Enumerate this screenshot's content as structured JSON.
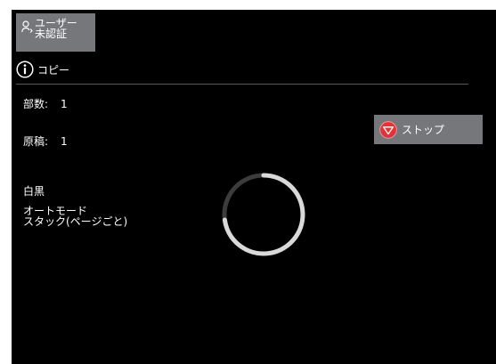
{
  "user": {
    "line1": "ユーザー",
    "line2": "未認証",
    "icon": "user-icon"
  },
  "header": {
    "title": "コピー",
    "icon": "info-icon"
  },
  "job": {
    "copies_label": "部数:",
    "copies_value": "1",
    "originals_label": "原稿:",
    "originals_value": "1",
    "color_mode": "白黒",
    "mode_line1": "オートモード",
    "mode_line2": "スタック(ページごと)"
  },
  "stop_button": {
    "label": "ストップ",
    "icon": "stop-icon",
    "icon_color": "#e1343a"
  },
  "colors": {
    "screen_bg": "#000000",
    "panel_gray": "#76777b",
    "spinner_track": "#3c3c3c",
    "spinner_arc": "#d9d9d9"
  }
}
